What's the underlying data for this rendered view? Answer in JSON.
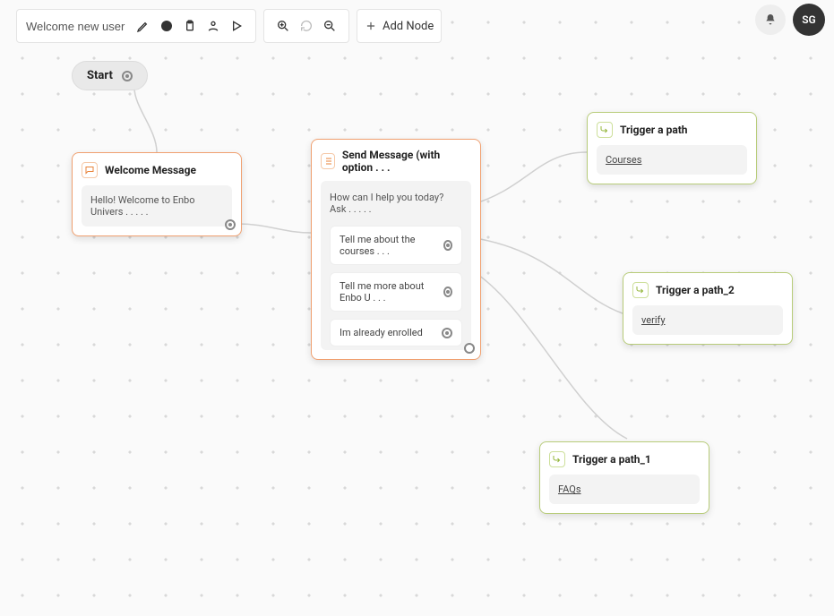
{
  "header": {
    "title": "Welcome new user",
    "add_node_label": "Add Node"
  },
  "user": {
    "initials": "SG"
  },
  "start": {
    "label": "Start"
  },
  "nodes": {
    "welcome": {
      "title": "Welcome Message",
      "body": "Hello! Welcome to Enbo Univers . . . . ."
    },
    "send": {
      "title": "Send Message (with option . . .",
      "prompt": "How can I help you today? Ask . . . . .",
      "options": [
        "Tell me about the courses . . .",
        "Tell me more about Enbo U . . .",
        "Im already enrolled"
      ]
    },
    "trigA": {
      "title": "Trigger a path",
      "link": "Courses"
    },
    "trigA2": {
      "title": "Trigger a path_2",
      "link": "verify"
    },
    "trigA1": {
      "title": "Trigger a path_1",
      "link": "FAQs"
    }
  }
}
